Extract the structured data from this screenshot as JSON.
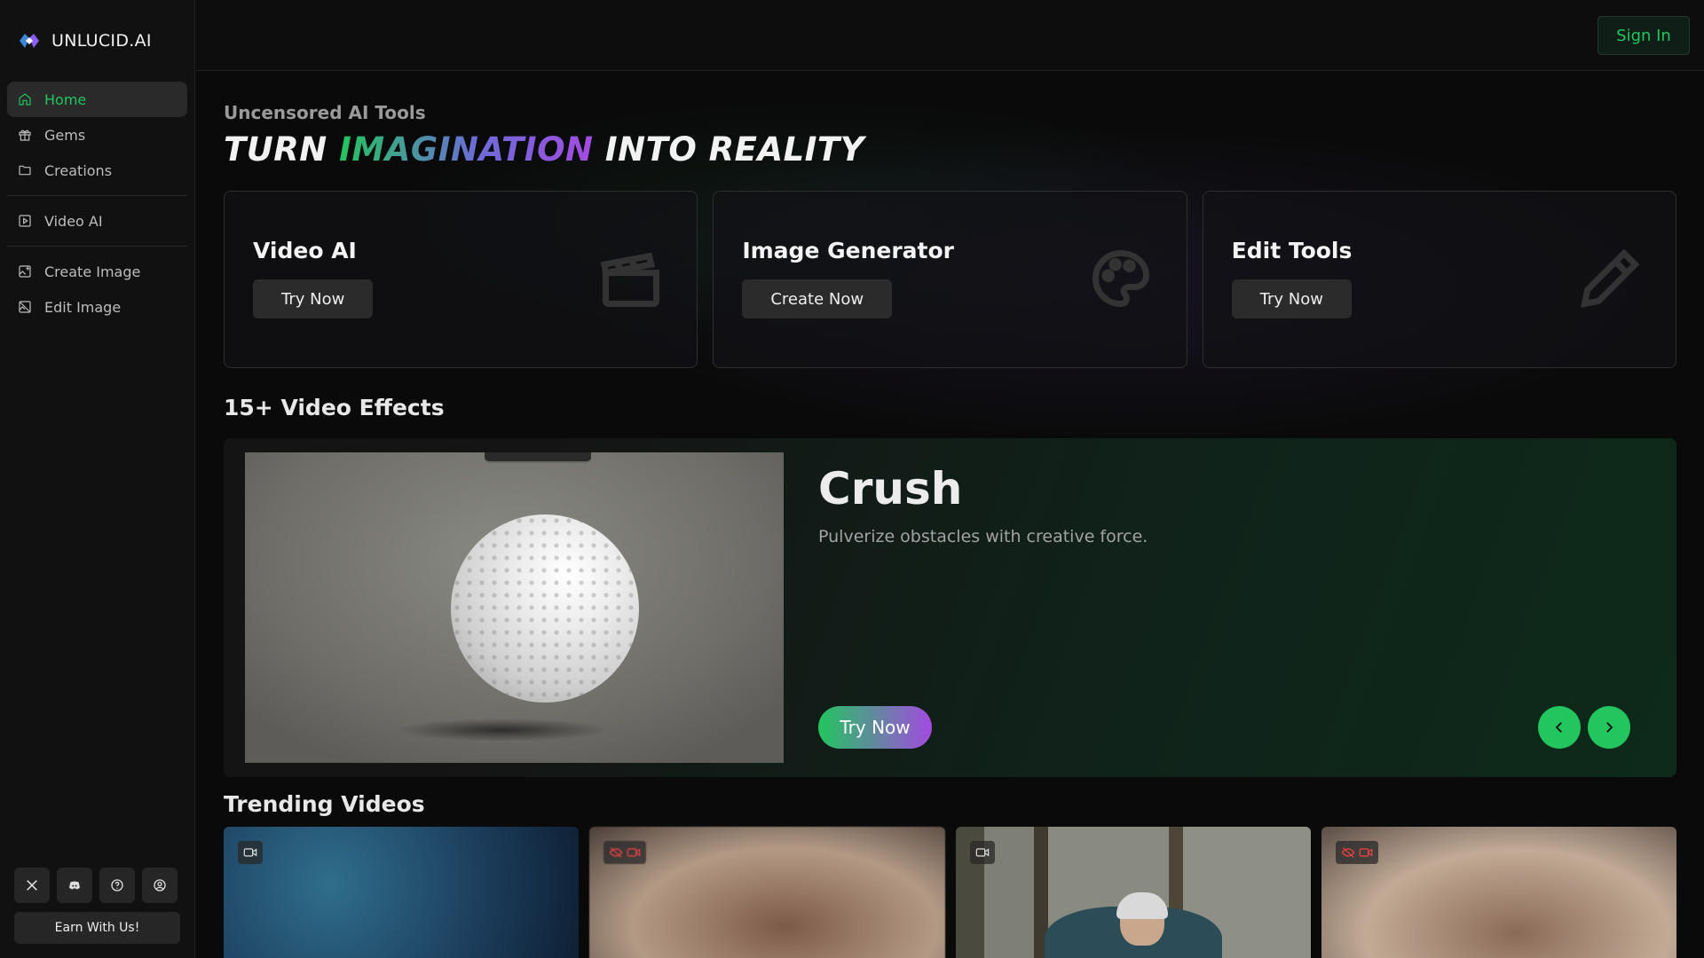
{
  "brand": {
    "name": "UNLUCID.AI"
  },
  "sidebar": {
    "items": [
      {
        "label": "Home",
        "icon": "home-icon",
        "active": true
      },
      {
        "label": "Gems",
        "icon": "gift-icon"
      },
      {
        "label": "Creations",
        "icon": "folder-icon"
      },
      {
        "label": "Video AI",
        "icon": "play-square-icon"
      },
      {
        "label": "Create Image",
        "icon": "image-plus-icon"
      },
      {
        "label": "Edit Image",
        "icon": "image-off-icon"
      }
    ],
    "social": [
      "x-icon",
      "discord-icon",
      "help-icon",
      "account-icon"
    ],
    "earn_label": "Earn With Us!"
  },
  "header": {
    "signin_label": "Sign In"
  },
  "hero": {
    "eyebrow": "Uncensored AI Tools",
    "title_part1": "TURN",
    "title_highlight": "IMAGINATION",
    "title_part2": "INTO REALITY"
  },
  "tools": [
    {
      "title": "Video AI",
      "button": "Try Now",
      "icon": "clapperboard-icon"
    },
    {
      "title": "Image Generator",
      "button": "Create Now",
      "icon": "palette-icon"
    },
    {
      "title": "Edit Tools",
      "button": "Try Now",
      "icon": "pencil-icon"
    }
  ],
  "effects": {
    "section_title": "15+ Video Effects",
    "current": {
      "name": "Crush",
      "description": "Pulverize obstacles with creative force.",
      "button": "Try Now"
    }
  },
  "trending": {
    "section_title": "Trending Videos",
    "items": [
      {
        "badge": "video-icon",
        "hidden": false
      },
      {
        "badge": "video-hidden-icon",
        "hidden": true
      },
      {
        "badge": "video-icon",
        "hidden": false
      },
      {
        "badge": "video-hidden-icon",
        "hidden": true
      }
    ]
  },
  "colors": {
    "accent": "#22c55e",
    "purple": "#a34be0",
    "background": "#0a0a0a"
  }
}
